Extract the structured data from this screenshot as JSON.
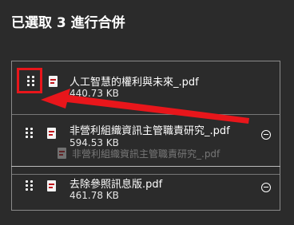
{
  "title": "已選取 3 進行合併",
  "files": [
    {
      "name": "人工智慧的權利與未來_.pdf",
      "size": "440.73 KB",
      "icon": "pdf-file-icon"
    },
    {
      "name": "非營利組織資訊主管職責研究_.pdf",
      "size": "594.53 KB",
      "icon": "pdf-file-icon"
    },
    {
      "name": "去除參照訊息版.pdf",
      "size": "461.78 KB",
      "icon": "pdf-file-icon"
    }
  ],
  "drag_ghost": {
    "name": "非營利組織資訊主管職責研究_.pdf"
  },
  "colors": {
    "background": "#2b2b2b",
    "annotation": "#e8161b",
    "text": "#ffffff"
  }
}
